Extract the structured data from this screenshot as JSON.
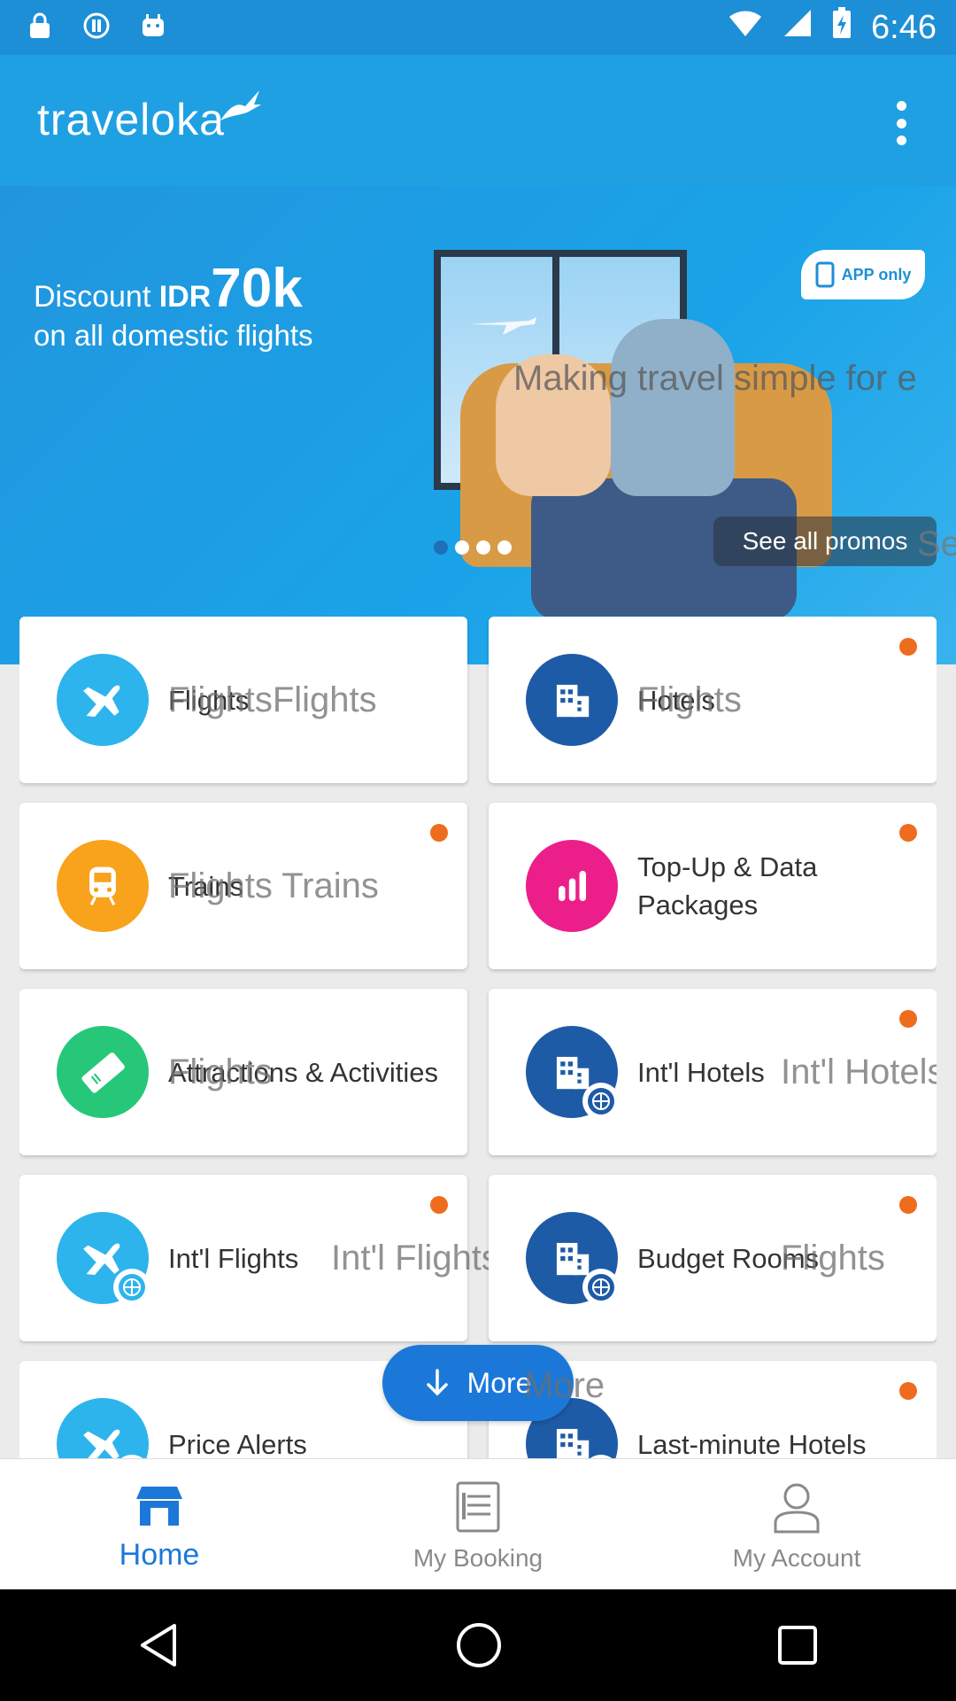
{
  "status_bar": {
    "time": "6:46"
  },
  "app_bar": {
    "brand": "traveloka"
  },
  "banner": {
    "discount_prefix": "Discount",
    "discount_currency": "IDR",
    "discount_amount": "70k",
    "discount_sub": "on all domestic flights",
    "app_only": "APP only",
    "tagline_overlay": "Making travel simple for e",
    "see_all_promos": "See all promos",
    "see_all_ghost": "Se",
    "carousel_total": 4,
    "carousel_active": 0
  },
  "tiles": [
    {
      "label": "Flights",
      "ghost": "FlightsFlights",
      "icon": "plane-icon",
      "color": "#2eb4ec",
      "dot": false
    },
    {
      "label": "Hotels",
      "ghost": "Flights",
      "icon": "hotel-building-icon",
      "color": "#1e5ba6",
      "dot": true
    },
    {
      "label": "Trains",
      "ghost": "Flights  Trains",
      "icon": "train-icon",
      "color": "#f9a21b",
      "dot": true
    },
    {
      "label": "Top-Up & Data Packages",
      "ghost": "",
      "icon": "bar-chart-icon",
      "color": "#ec1f8a",
      "dot": true
    },
    {
      "label": "Attractions & Activities",
      "ghost": "Flights",
      "icon": "ticket-icon",
      "color": "#27c77a",
      "dot": false
    },
    {
      "label": "Int'l Hotels",
      "ghost": "Int'l Hotels",
      "icon": "intl-hotel-icon",
      "color": "#1e5ba6",
      "dot": true
    },
    {
      "label": "Int'l Flights",
      "ghost": "Int'l Flights",
      "icon": "intl-plane-icon",
      "color": "#2eb4ec",
      "dot": true
    },
    {
      "label": "Budget Rooms",
      "ghost": "Flights",
      "icon": "budget-hotel-icon",
      "color": "#1e5ba6",
      "dot": true
    },
    {
      "label": "Price Alerts",
      "ghost": "",
      "icon": "price-alert-icon",
      "color": "#2eb4ec",
      "dot": false
    },
    {
      "label": "Last-minute Hotels",
      "ghost": "",
      "icon": "last-minute-hotel-icon",
      "color": "#1e5ba6",
      "dot": true
    }
  ],
  "more_button": {
    "label": "More",
    "ghost": "More"
  },
  "bottom_nav": [
    {
      "label": "Home",
      "icon": "home-store-icon",
      "active": true
    },
    {
      "label": "My Booking",
      "icon": "booking-list-icon",
      "active": false
    },
    {
      "label": "My Account",
      "icon": "account-icon",
      "active": false
    }
  ]
}
